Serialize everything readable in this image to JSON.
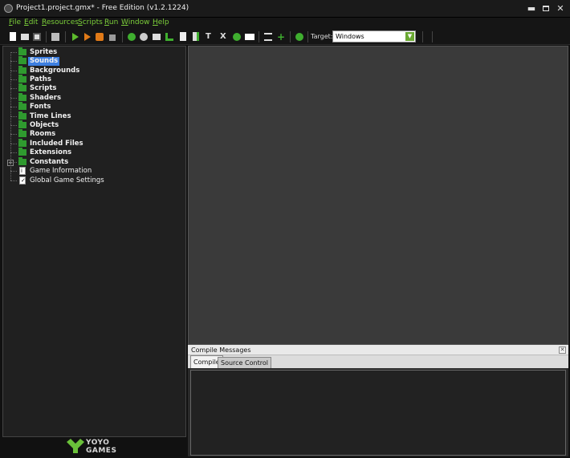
{
  "window": {
    "title": "Project1.project.gmx*  -  Free Edition (v1.2.1224)",
    "controls": {
      "minimize": "▬",
      "close": "✕"
    }
  },
  "menu": [
    {
      "label": "File",
      "key": "F",
      "rest": "ile"
    },
    {
      "label": "Edit",
      "key": "E",
      "rest": "dit"
    },
    {
      "label": "Resources",
      "key": "R",
      "rest": "esources"
    },
    {
      "label": "Scripts",
      "key": "S",
      "rest": "cripts"
    },
    {
      "label": "Run",
      "key": "R",
      "rest": "un"
    },
    {
      "label": "Window",
      "key": "W",
      "rest": "indow"
    },
    {
      "label": "Help",
      "key": "H",
      "rest": "elp"
    }
  ],
  "toolbar": {
    "target_label": "Target:",
    "target_value": "Windows",
    "icons": [
      "new-icon",
      "open-icon",
      "save-icon",
      "export-icon",
      "run-icon",
      "debug-icon",
      "stop-icon",
      "clean-icon",
      "sprite-icon",
      "sound-icon",
      "background-icon",
      "path-icon",
      "script-icon",
      "shader-icon",
      "font-icon",
      "timeline-icon",
      "object-icon",
      "room-icon",
      "game-info-icon",
      "global-settings-icon",
      "extensions-icon",
      "help-icon"
    ]
  },
  "tree": {
    "items": [
      {
        "label": "Sprites",
        "type": "folder"
      },
      {
        "label": "Sounds",
        "type": "folder",
        "selected": true
      },
      {
        "label": "Backgrounds",
        "type": "folder"
      },
      {
        "label": "Paths",
        "type": "folder"
      },
      {
        "label": "Scripts",
        "type": "folder"
      },
      {
        "label": "Shaders",
        "type": "folder"
      },
      {
        "label": "Fonts",
        "type": "folder"
      },
      {
        "label": "Time Lines",
        "type": "folder"
      },
      {
        "label": "Objects",
        "type": "folder"
      },
      {
        "label": "Rooms",
        "type": "folder"
      },
      {
        "label": "Included Files",
        "type": "folder"
      },
      {
        "label": "Extensions",
        "type": "folder"
      },
      {
        "label": "Constants",
        "type": "folder",
        "expandable": true
      },
      {
        "label": "Game Information",
        "type": "doc"
      },
      {
        "label": "Global Game Settings",
        "type": "doc"
      }
    ]
  },
  "logo": {
    "line1": "YOYO",
    "line2": "GAMES"
  },
  "compile": {
    "title": "Compile Messages",
    "tabs": [
      "Compile",
      "Source Control"
    ]
  },
  "colors": {
    "accent_green": "#7ccf3a",
    "selection_blue": "#3d7fe0",
    "folder_green": "#2f9a2f"
  }
}
